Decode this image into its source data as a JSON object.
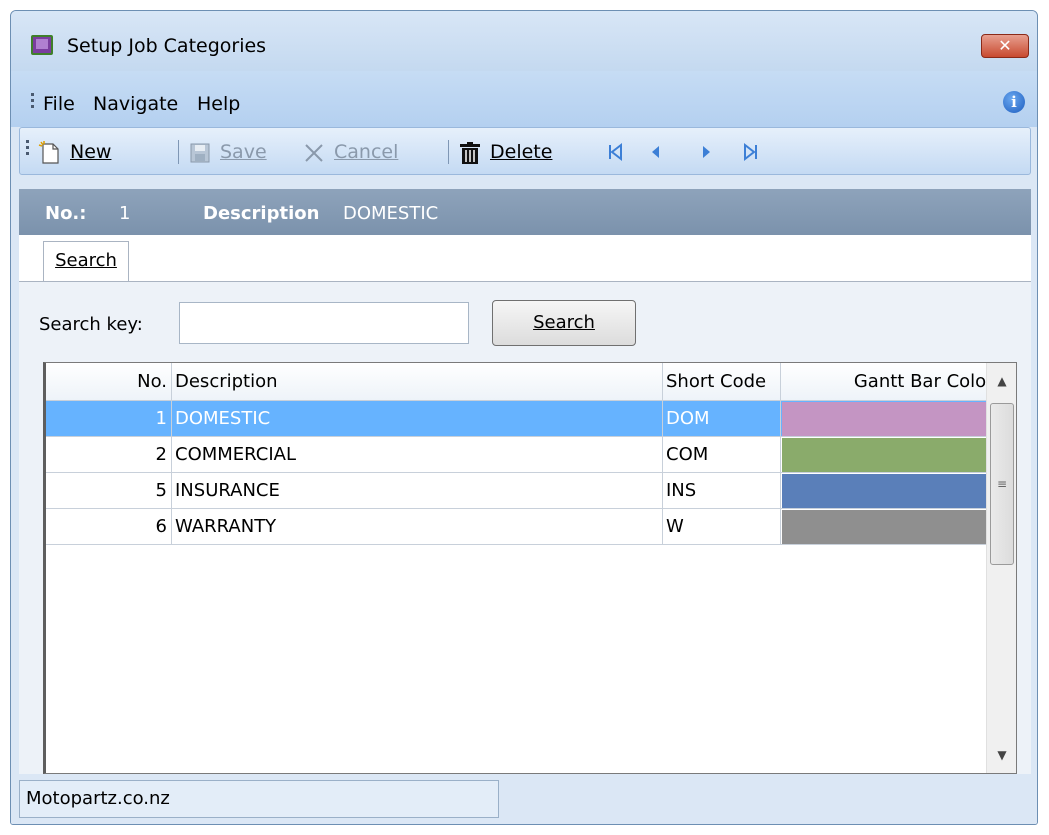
{
  "window": {
    "title": "Setup Job Categories"
  },
  "menu": {
    "file": "File",
    "navigate": "Navigate",
    "help": "Help"
  },
  "toolbar": {
    "new_label": "New",
    "save_label": "Save",
    "cancel_label": "Cancel",
    "delete_label": "Delete"
  },
  "header": {
    "no_label": "No.:",
    "no_value": "1",
    "description_label": "Description",
    "description_value": "DOMESTIC"
  },
  "tabs": [
    {
      "label": "Search"
    }
  ],
  "search": {
    "label": "Search key:",
    "value": "",
    "placeholder": "",
    "button_label": "Search"
  },
  "grid": {
    "columns": [
      "No.",
      "Description",
      "Short Code",
      "Gantt Bar Colour"
    ],
    "rows": [
      {
        "no": "1",
        "description": "DOMESTIC",
        "short_code": "DOM",
        "colour": "#c495c3",
        "selected": true
      },
      {
        "no": "2",
        "description": "COMMERCIAL",
        "short_code": "COM",
        "colour": "#8aab6b",
        "selected": false
      },
      {
        "no": "5",
        "description": "INSURANCE",
        "short_code": "INS",
        "colour": "#5a7fb9",
        "selected": false
      },
      {
        "no": "6",
        "description": "WARRANTY",
        "short_code": "W",
        "colour": "#8f8f8f",
        "selected": false
      }
    ]
  },
  "status": {
    "text": "Motopartz.co.nz"
  },
  "colors": {
    "selection": "#66b3ff",
    "header_strip": "#8ea3bb"
  }
}
